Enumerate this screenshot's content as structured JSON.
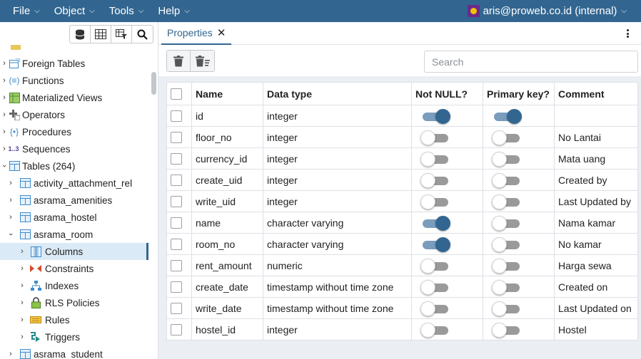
{
  "menubar": {
    "menus": [
      "File",
      "Object",
      "Tools",
      "Help"
    ],
    "user": "aris@proweb.co.id (internal)"
  },
  "tree": {
    "items": [
      {
        "label": "Foreign Tables",
        "icon": "foreign-table-icon",
        "expanded": false
      },
      {
        "label": "Functions",
        "icon": "function-icon",
        "expanded": false
      },
      {
        "label": "Materialized Views",
        "icon": "materialized-view-icon",
        "expanded": false
      },
      {
        "label": "Operators",
        "icon": "operator-icon",
        "expanded": false
      },
      {
        "label": "Procedures",
        "icon": "procedure-icon",
        "expanded": false
      },
      {
        "label": "Sequences",
        "icon": "sequence-icon",
        "expanded": false
      },
      {
        "label": "Tables",
        "count": "(264)",
        "icon": "table-icon",
        "expanded": true
      },
      {
        "label": "activity_attachment_rel",
        "icon": "table-icon",
        "expanded": false
      },
      {
        "label": "asrama_amenities",
        "icon": "table-icon",
        "expanded": false
      },
      {
        "label": "asrama_hostel",
        "icon": "table-icon",
        "expanded": false
      },
      {
        "label": "asrama_room",
        "icon": "table-icon",
        "expanded": true
      },
      {
        "label": "Columns",
        "icon": "columns-icon",
        "expanded": false,
        "selected": true
      },
      {
        "label": "Constraints",
        "icon": "constraints-icon",
        "expanded": false
      },
      {
        "label": "Indexes",
        "icon": "indexes-icon",
        "expanded": false
      },
      {
        "label": "RLS Policies",
        "icon": "rls-policy-icon",
        "expanded": false
      },
      {
        "label": "Rules",
        "icon": "rules-icon",
        "expanded": false
      },
      {
        "label": "Triggers",
        "icon": "triggers-icon",
        "expanded": false
      },
      {
        "label": "asrama_student",
        "icon": "table-icon",
        "expanded": false
      }
    ]
  },
  "tabs": [
    {
      "label": "Properties",
      "active": true
    }
  ],
  "search": {
    "placeholder": "Search",
    "value": ""
  },
  "columns_table": {
    "headers": [
      "Name",
      "Data type",
      "Not NULL?",
      "Primary key?",
      "Comment"
    ],
    "rows": [
      {
        "name": "id",
        "type": "integer",
        "not_null": true,
        "primary_key": true,
        "comment": ""
      },
      {
        "name": "floor_no",
        "type": "integer",
        "not_null": false,
        "primary_key": false,
        "comment": "No Lantai"
      },
      {
        "name": "currency_id",
        "type": "integer",
        "not_null": false,
        "primary_key": false,
        "comment": "Mata uang"
      },
      {
        "name": "create_uid",
        "type": "integer",
        "not_null": false,
        "primary_key": false,
        "comment": "Created by"
      },
      {
        "name": "write_uid",
        "type": "integer",
        "not_null": false,
        "primary_key": false,
        "comment": "Last Updated by"
      },
      {
        "name": "name",
        "type": "character varying",
        "not_null": true,
        "primary_key": false,
        "comment": "Nama kamar"
      },
      {
        "name": "room_no",
        "type": "character varying",
        "not_null": true,
        "primary_key": false,
        "comment": "No kamar"
      },
      {
        "name": "rent_amount",
        "type": "numeric",
        "not_null": false,
        "primary_key": false,
        "comment": "Harga sewa"
      },
      {
        "name": "create_date",
        "type": "timestamp without time zone",
        "not_null": false,
        "primary_key": false,
        "comment": "Created on"
      },
      {
        "name": "write_date",
        "type": "timestamp without time zone",
        "not_null": false,
        "primary_key": false,
        "comment": "Last Updated on"
      },
      {
        "name": "hostel_id",
        "type": "integer",
        "not_null": false,
        "primary_key": false,
        "comment": "Hostel"
      }
    ]
  },
  "colors": {
    "brand": "#326690",
    "selected_bg": "#dbeaf7",
    "grid_bg": "#ebeef3",
    "toggle_on": "#326690",
    "toggle_off": "#9a9a9a"
  }
}
